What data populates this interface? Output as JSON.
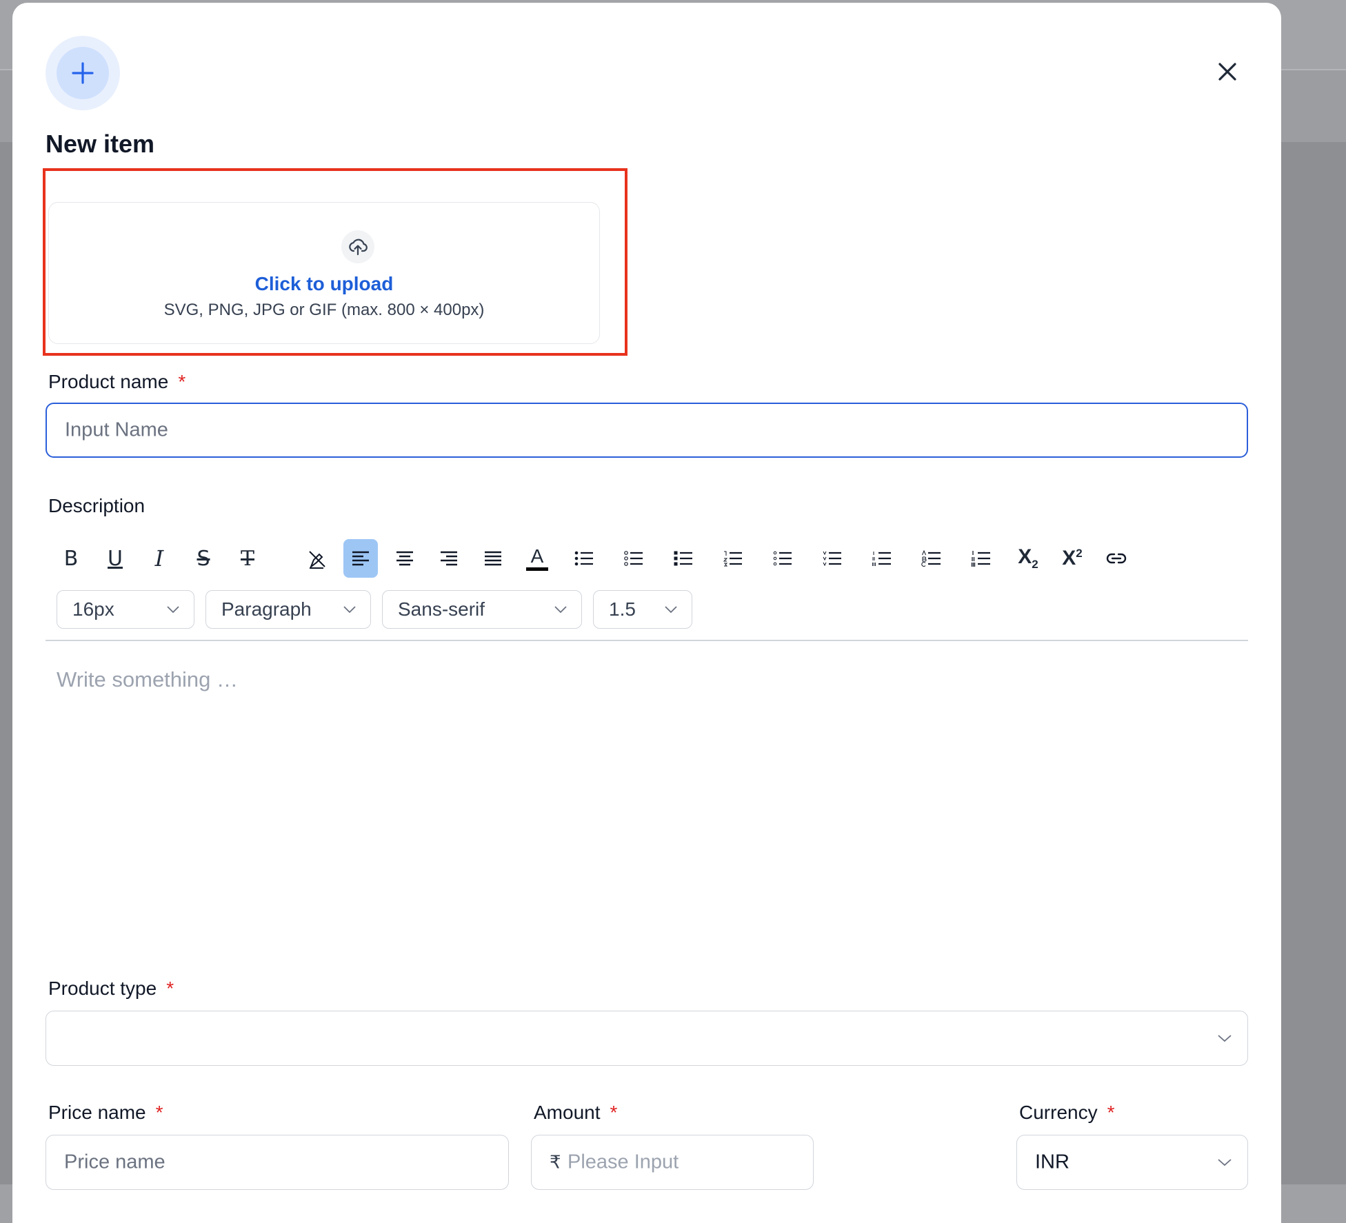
{
  "dialog": {
    "title": "New item",
    "header_icon": "plus-icon",
    "close_icon": "close-icon"
  },
  "upload": {
    "icon": "upload-cloud-icon",
    "link_text": "Click to upload",
    "hint": "SVG, PNG, JPG or GIF (max. 800 × 400px)"
  },
  "product_name": {
    "label": "Product name",
    "required_mark": "*",
    "placeholder": "Input Name"
  },
  "description": {
    "label": "Description",
    "toolbar": [
      {
        "icon": "bold-icon"
      },
      {
        "icon": "underline-icon"
      },
      {
        "icon": "italic-icon"
      },
      {
        "icon": "strikethrough-icon"
      },
      {
        "icon": "clear-format-icon"
      },
      {
        "icon": "clear-highlight-icon"
      },
      {
        "icon": "align-left-icon",
        "active": true
      },
      {
        "icon": "align-center-icon"
      },
      {
        "icon": "align-right-icon"
      },
      {
        "icon": "align-justify-icon"
      },
      {
        "icon": "text-color-icon"
      },
      {
        "icon": "bullet-list-icon"
      },
      {
        "icon": "circle-list-icon"
      },
      {
        "icon": "square-list-icon"
      },
      {
        "icon": "ordered-list-icon"
      },
      {
        "icon": "lower-alpha-list-icon"
      },
      {
        "icon": "lower-greek-list-icon"
      },
      {
        "icon": "lower-roman-list-icon"
      },
      {
        "icon": "upper-alpha-list-icon"
      },
      {
        "icon": "upper-roman-list-icon"
      },
      {
        "icon": "subscript-icon"
      },
      {
        "icon": "superscript-icon"
      },
      {
        "icon": "link-icon"
      }
    ],
    "font_size": "16px",
    "block_type": "Paragraph",
    "font_family": "Sans-serif",
    "line_height": "1.5",
    "editor_placeholder": "Write something …",
    "subscript_glyph": "X",
    "subscript_mark": "2",
    "superscript_glyph": "X",
    "superscript_mark": "2",
    "text_color_glyph": "A",
    "bold_glyph": "B",
    "underline_glyph": "U",
    "italic_glyph": "I",
    "strike_glyph": "S",
    "clear_format_glyph": "T"
  },
  "product_type": {
    "label": "Product type",
    "required_mark": "*",
    "value": ""
  },
  "price_name": {
    "label": "Price name",
    "required_mark": "*",
    "placeholder": "Price name"
  },
  "amount": {
    "label": "Amount",
    "required_mark": "*",
    "currency_symbol": "₹",
    "placeholder": "Please Input"
  },
  "currency": {
    "label": "Currency",
    "required_mark": "*",
    "value": "INR"
  },
  "colors": {
    "accent": "#1d5ed8",
    "focus_border": "#2b5fd9",
    "required": "#e02424",
    "highlight_box": "#e8321d",
    "active_tool": "#9dc6f5"
  }
}
